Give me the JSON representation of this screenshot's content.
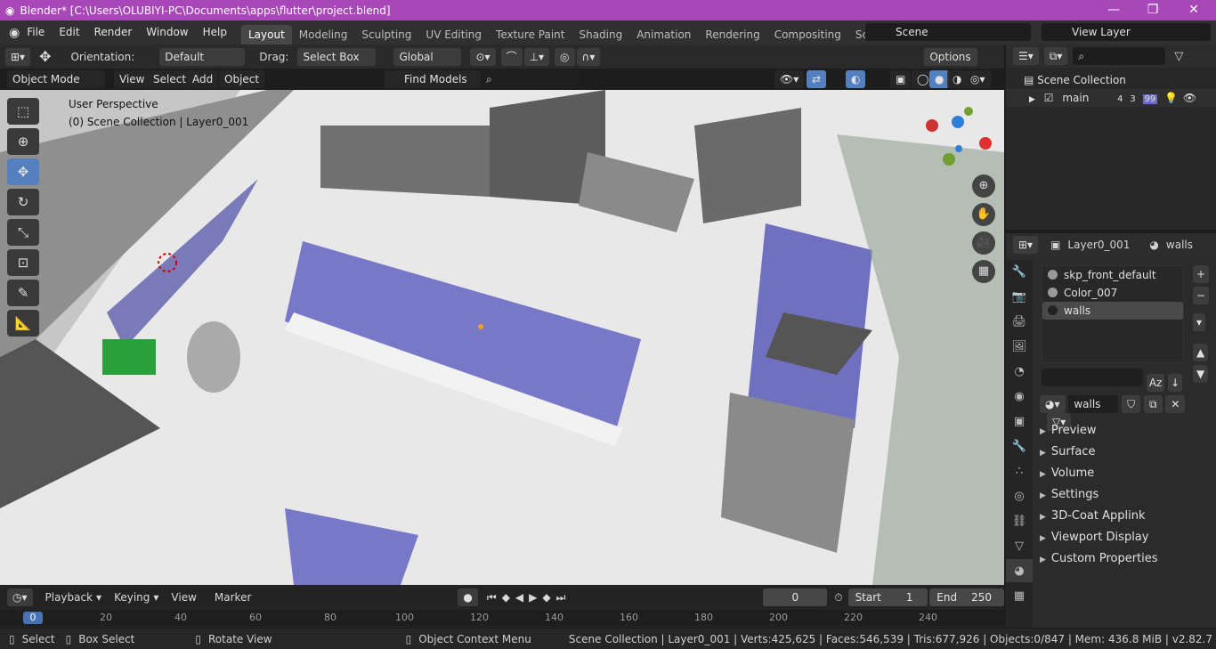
{
  "title_bar": {
    "title": "Blender* [C:\\Users\\OLUBIYI-PC\\Documents\\apps\\flutter\\project.blend]",
    "minimize": "—",
    "maximize": "❐",
    "close": "✕"
  },
  "menu": [
    "File",
    "Edit",
    "Render",
    "Window",
    "Help"
  ],
  "workspaces": [
    {
      "label": "Layout",
      "active": true
    },
    {
      "label": "Modeling"
    },
    {
      "label": "Sculpting"
    },
    {
      "label": "UV Editing"
    },
    {
      "label": "Texture Paint"
    },
    {
      "label": "Shading"
    },
    {
      "label": "Animation"
    },
    {
      "label": "Rendering"
    },
    {
      "label": "Compositing"
    },
    {
      "label": "Scripting"
    }
  ],
  "scene": {
    "name": "Scene",
    "view_layer": "View Layer"
  },
  "viewport_header": {
    "orientation_label": "Orientation:",
    "orientation_value": "Default",
    "drag_label": "Drag:",
    "drag_value": "Select Box",
    "transform_space": "Global",
    "options": "Options",
    "mode": "Object Mode",
    "menus": [
      "View",
      "Select",
      "Add",
      "Object"
    ],
    "find_models": "Find Models"
  },
  "viewport": {
    "perspective": "User Perspective",
    "collection": "(0) Scene Collection | Layer0_001"
  },
  "outliner": {
    "root": "Scene Collection",
    "items": [
      {
        "label": "main",
        "counts": [
          "4",
          "3",
          "99"
        ]
      }
    ]
  },
  "properties": {
    "object": "Layer0_001",
    "material": "walls",
    "materials": [
      {
        "name": "skp_front_default"
      },
      {
        "name": "Color_007"
      },
      {
        "name": "walls",
        "active": true
      }
    ],
    "material_field": "walls",
    "sections": [
      "Preview",
      "Surface",
      "Volume",
      "Settings",
      "3D-Coat Applink",
      "Viewport Display",
      "Custom Properties"
    ]
  },
  "timeline": {
    "menus": [
      "Playback",
      "Keying",
      "View",
      "Marker"
    ],
    "current_frame": "0",
    "start_label": "Start",
    "start": "1",
    "end_label": "End",
    "end": "250",
    "ticks": [
      "0",
      "20",
      "40",
      "60",
      "80",
      "100",
      "120",
      "140",
      "160",
      "180",
      "200",
      "220",
      "240"
    ]
  },
  "status_bar": {
    "select": "Select",
    "box_select": "Box Select",
    "rotate": "Rotate View",
    "context_menu": "Object Context Menu",
    "stats": "Scene Collection | Layer0_001 | Verts:425,625 | Faces:546,539 | Tris:677,926 | Objects:0/847 | Mem: 436.8 MiB | v2.82.7"
  },
  "colors": {
    "title_bar": "#a848b8",
    "accent": "#5580bf",
    "counter_purple": "#6b6bc4"
  }
}
